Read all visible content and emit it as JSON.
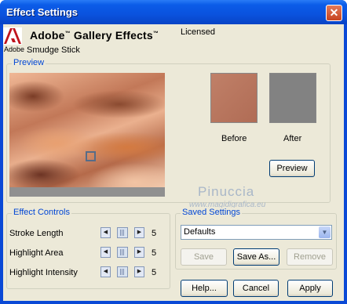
{
  "window": {
    "title": "Effect Settings",
    "close_glyph": "✕"
  },
  "header": {
    "brand_small": "Adobe",
    "product": "Adobe",
    "product_rest": "Gallery Effects",
    "filter_name": "Smudge Stick",
    "license": "Licensed"
  },
  "preview": {
    "legend": "Preview",
    "before_label": "Before",
    "after_label": "After",
    "preview_button": "Preview"
  },
  "watermark": {
    "line1": "Pinuccia",
    "line2": "www.magidigrafica.eu"
  },
  "effect_controls": {
    "legend": "Effect Controls",
    "rows": [
      {
        "label": "Stroke Length",
        "value": "5"
      },
      {
        "label": "Highlight Area",
        "value": "5"
      },
      {
        "label": "Highlight Intensity",
        "value": "5"
      }
    ]
  },
  "saved_settings": {
    "legend": "Saved Settings",
    "selected": "Defaults",
    "save": "Save",
    "save_as": "Save As...",
    "remove": "Remove"
  },
  "footer": {
    "help": "Help...",
    "cancel": "Cancel",
    "apply": "Apply"
  },
  "colors": {
    "title_bar": "#0a52de",
    "client_bg": "#ece9d8",
    "legend_text": "#0046d5"
  }
}
